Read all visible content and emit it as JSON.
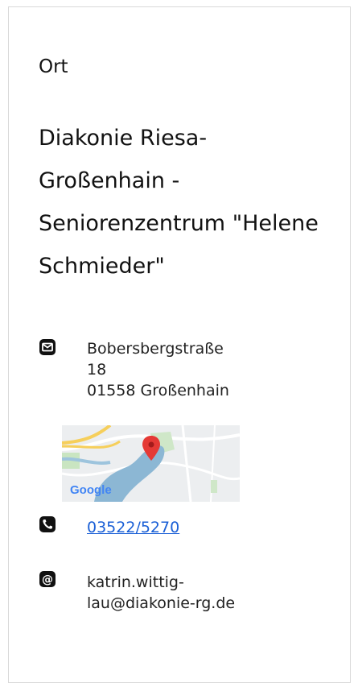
{
  "location": {
    "section_label": "Ort",
    "title_lines": [
      "Diakonie Riesa-",
      "Großenhain -",
      "Seniorenzentrum \"Helene",
      "Schmieder\""
    ],
    "address": {
      "icon": "envelope-icon",
      "lines": [
        "Bobersbergstraße",
        "18",
        "01558 Großenhain"
      ]
    },
    "map": {
      "label": "Google",
      "marker_icon": "map-pin-icon"
    },
    "phone": {
      "icon": "phone-icon",
      "number": "03522/5270"
    },
    "email": {
      "icon": "at-icon",
      "lines": [
        "katrin.wittig-",
        "lau@diakonie-rg.de"
      ]
    }
  },
  "colors": {
    "link": "#1a5fd6",
    "border": "#d9d9d9",
    "marker": "#e53935"
  }
}
